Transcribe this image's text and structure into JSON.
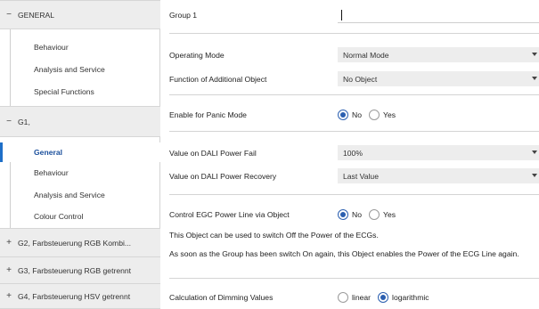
{
  "sidebar": {
    "groups": [
      {
        "symbol": "−",
        "label": "GENERAL"
      },
      {
        "symbol": "−",
        "label": "G1,"
      },
      {
        "symbol": "+",
        "label": "G2, Farbsteuerung RGB Kombi..."
      },
      {
        "symbol": "+",
        "label": "G3, Farbsteuerung RGB getrennt"
      },
      {
        "symbol": "+",
        "label": "G4, Farbsteuerung HSV getrennt"
      }
    ],
    "general_items": [
      "Behaviour",
      "Analysis and Service",
      "Special Functions"
    ],
    "g1_items": [
      "General",
      "Behaviour",
      "Analysis and Service",
      "Colour Control"
    ]
  },
  "main": {
    "group_name": {
      "label": "Group 1",
      "value": ""
    },
    "operating_mode": {
      "label": "Operating Mode",
      "value": "Normal Mode"
    },
    "additional_object": {
      "label": "Function of Additional Object",
      "value": "No Object"
    },
    "panic_mode": {
      "label": "Enable for Panic Mode",
      "options": [
        "No",
        "Yes"
      ],
      "selected": "No"
    },
    "power_fail": {
      "label": "Value on DALI Power Fail",
      "value": "100%"
    },
    "power_recovery": {
      "label": "Value on DALI Power Recovery",
      "value": "Last Value"
    },
    "egc_power": {
      "label": "Control EGC Power Line via Object",
      "options": [
        "No",
        "Yes"
      ],
      "selected": "No"
    },
    "info_1": "This Object can be used to switch Off the Power of the ECGs.",
    "info_2": "As soon as the Group has been switch On again, this Object enables the Power of the ECG Line again.",
    "dimming": {
      "label": "Calculation of Dimming Values",
      "options": [
        "linear",
        "logarithmic"
      ],
      "selected": "logarithmic"
    }
  }
}
